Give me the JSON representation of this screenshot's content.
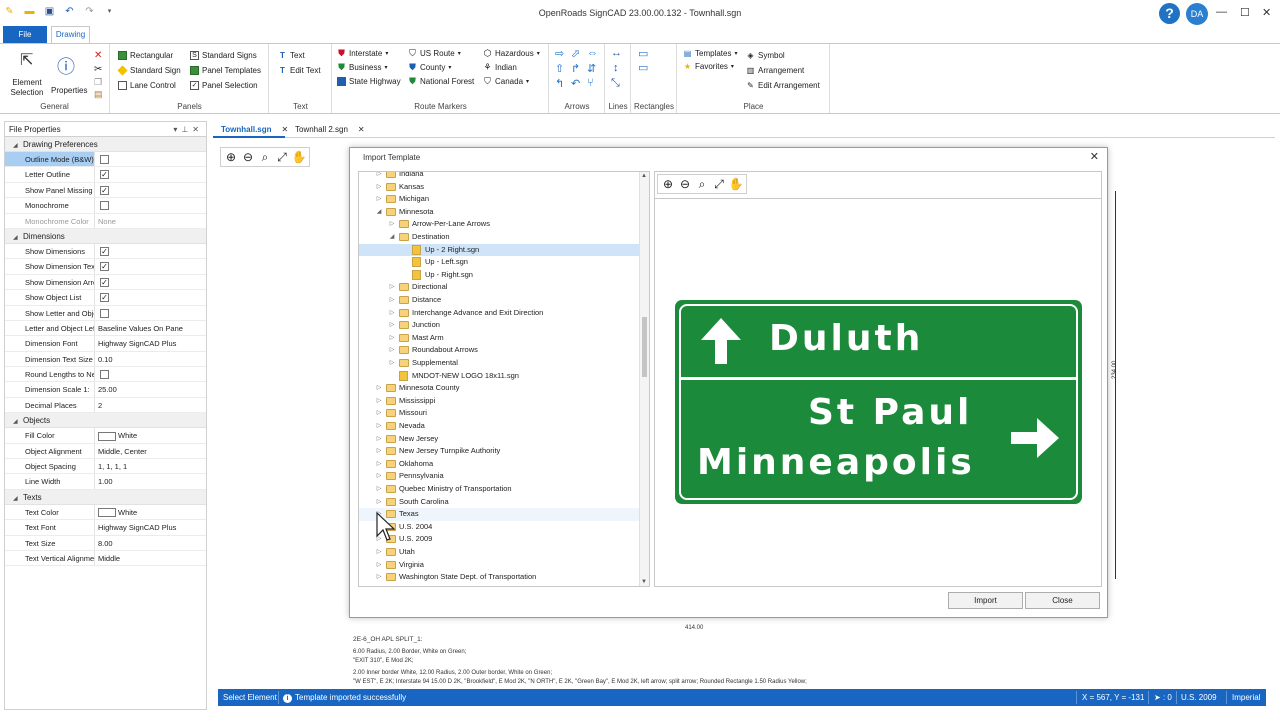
{
  "app": {
    "title": "OpenRoads SignCAD 23.00.00.132 - Townhall.sgn",
    "user_initials": "DA"
  },
  "ribbon": {
    "tabs": [
      "File",
      "Drawing"
    ],
    "general": {
      "label": "General",
      "element_selection": "Element Selection",
      "properties": "Properties"
    },
    "panels": {
      "label": "Panels",
      "rectangular": "Rectangular",
      "standard_sign": "Standard Sign",
      "lane_control": "Lane Control",
      "standard_signs": "Standard Signs",
      "panel_templates": "Panel Templates",
      "panel_selection": "Panel Selection"
    },
    "text": {
      "label": "Text",
      "text": "Text",
      "edit_text": "Edit Text"
    },
    "route_markers": {
      "label": "Route Markers",
      "interstate": "Interstate",
      "business": "Business",
      "state_highway": "State Highway",
      "us_route": "US Route",
      "county": "County",
      "national_forest": "National Forest",
      "hazardous": "Hazardous",
      "indian": "Indian",
      "canada": "Canada"
    },
    "arrows": {
      "label": "Arrows"
    },
    "lines": {
      "label": "Lines"
    },
    "rectangles": {
      "label": "Rectangles"
    },
    "place": {
      "label": "Place",
      "templates": "Templates",
      "favorites": "Favorites",
      "symbol": "Symbol",
      "arrangement": "Arrangement",
      "edit_arrangement": "Edit Arrangement"
    }
  },
  "properties_panel": {
    "title": "File Properties",
    "categories": [
      {
        "name": "Drawing Preferences",
        "rows": [
          {
            "name": "Outline Mode (B&W)",
            "type": "check",
            "checked": false,
            "selected": true
          },
          {
            "name": "Letter Outline",
            "type": "check",
            "checked": true
          },
          {
            "name": "Show Panel Missing Ed...",
            "type": "check",
            "checked": true
          },
          {
            "name": "Monochrome",
            "type": "check",
            "checked": false
          },
          {
            "name": "Monochrome Color",
            "type": "text",
            "value": "None",
            "disabled": true
          }
        ]
      },
      {
        "name": "Dimensions",
        "rows": [
          {
            "name": "Show Dimensions",
            "type": "check",
            "checked": true
          },
          {
            "name": "Show Dimension Texts",
            "type": "check",
            "checked": true
          },
          {
            "name": "Show Dimension Arrows",
            "type": "check",
            "checked": true
          },
          {
            "name": "Show Object List",
            "type": "check",
            "checked": true
          },
          {
            "name": "Show Letter and Object...",
            "type": "check",
            "checked": false
          },
          {
            "name": "Letter and Object Lefts...",
            "type": "text",
            "value": "Baseline Values On Pane"
          },
          {
            "name": "Dimension Font",
            "type": "text",
            "value": "Highway SignCAD Plus"
          },
          {
            "name": "Dimension Text Size",
            "type": "text",
            "value": "0.10"
          },
          {
            "name": "Round Lengths to Neare...",
            "type": "check",
            "checked": false
          },
          {
            "name": "Dimension Scale 1:",
            "type": "text",
            "value": "25.00"
          },
          {
            "name": "Decimal Places",
            "type": "text",
            "value": "2"
          }
        ]
      },
      {
        "name": "Objects",
        "rows": [
          {
            "name": "Fill Color",
            "type": "color",
            "value": "White"
          },
          {
            "name": "Object Alignment",
            "type": "text",
            "value": "Middle, Center"
          },
          {
            "name": "Object Spacing",
            "type": "text",
            "value": "1, 1, 1, 1"
          },
          {
            "name": "Line Width",
            "type": "text",
            "value": "1.00"
          }
        ]
      },
      {
        "name": "Texts",
        "rows": [
          {
            "name": "Text Color",
            "type": "color",
            "value": "White"
          },
          {
            "name": "Text Font",
            "type": "text",
            "value": "Highway SignCAD Plus"
          },
          {
            "name": "Text Size",
            "type": "text",
            "value": "8.00"
          },
          {
            "name": "Text Vertical Alignment",
            "type": "text",
            "value": "Middle"
          }
        ]
      }
    ]
  },
  "doc_tabs": [
    {
      "label": "Townhall.sgn",
      "active": true
    },
    {
      "label": "Townhall 2.sgn",
      "active": false
    }
  ],
  "background_drawing": {
    "title_line": "2E-6_OH APL SPLIT_1:",
    "lines": [
      "6.00 Radius, 2.00 Border, White on Green;",
      "\"EXIT 310\",  E Mod 2K;",
      "2.00 Inner border White, 12.00 Radius, 2.00 Outer border, White on Green;",
      "\"W EST\",  E 2K; Interstate 94 15.00 D 2K, \"Brookfield\",  E Mod 2K, \"N ORTH\",  E 2K, \"Green Bay\",  E Mod 2K, left arrow; split arrow; Rounded Rectangle 1.50 Radius Yellow;"
    ],
    "dimension_width": "414.00",
    "dimension_height": "234.00"
  },
  "dialog": {
    "title": "Import Template",
    "tree": [
      {
        "label": "Indiana",
        "level": 0,
        "expander": "collapsed",
        "kind": "folder"
      },
      {
        "label": "Kansas",
        "level": 0,
        "expander": "collapsed",
        "kind": "folder"
      },
      {
        "label": "Michigan",
        "level": 0,
        "expander": "collapsed",
        "kind": "folder"
      },
      {
        "label": "Minnesota",
        "level": 0,
        "expander": "expanded",
        "kind": "folder"
      },
      {
        "label": "Arrow-Per-Lane Arrows",
        "level": 1,
        "expander": "collapsed",
        "kind": "folder"
      },
      {
        "label": "Destination",
        "level": 1,
        "expander": "expanded",
        "kind": "folder"
      },
      {
        "label": "Up - 2 Right.sgn",
        "level": 2,
        "expander": "none",
        "kind": "file",
        "selected": true
      },
      {
        "label": "Up - Left.sgn",
        "level": 2,
        "expander": "none",
        "kind": "file"
      },
      {
        "label": "Up - Right.sgn",
        "level": 2,
        "expander": "none",
        "kind": "file"
      },
      {
        "label": "Directional",
        "level": 1,
        "expander": "collapsed",
        "kind": "folder"
      },
      {
        "label": "Distance",
        "level": 1,
        "expander": "collapsed",
        "kind": "folder"
      },
      {
        "label": "Interchange Advance and Exit Direction",
        "level": 1,
        "expander": "collapsed",
        "kind": "folder"
      },
      {
        "label": "Junction",
        "level": 1,
        "expander": "collapsed",
        "kind": "folder"
      },
      {
        "label": "Mast Arm",
        "level": 1,
        "expander": "collapsed",
        "kind": "folder"
      },
      {
        "label": "Roundabout Arrows",
        "level": 1,
        "expander": "collapsed",
        "kind": "folder"
      },
      {
        "label": "Supplemental",
        "level": 1,
        "expander": "collapsed",
        "kind": "folder"
      },
      {
        "label": "MNDOT-NEW LOGO 18x11.sgn",
        "level": 1,
        "expander": "none",
        "kind": "file"
      },
      {
        "label": "Minnesota County",
        "level": 0,
        "expander": "collapsed",
        "kind": "folder"
      },
      {
        "label": "Mississippi",
        "level": 0,
        "expander": "collapsed",
        "kind": "folder"
      },
      {
        "label": "Missouri",
        "level": 0,
        "expander": "collapsed",
        "kind": "folder"
      },
      {
        "label": "Nevada",
        "level": 0,
        "expander": "collapsed",
        "kind": "folder"
      },
      {
        "label": "New Jersey",
        "level": 0,
        "expander": "collapsed",
        "kind": "folder"
      },
      {
        "label": "New Jersey Turnpike Authority",
        "level": 0,
        "expander": "collapsed",
        "kind": "folder"
      },
      {
        "label": "Oklahoma",
        "level": 0,
        "expander": "collapsed",
        "kind": "folder"
      },
      {
        "label": "Pennsylvania",
        "level": 0,
        "expander": "collapsed",
        "kind": "folder"
      },
      {
        "label": "Quebec Ministry of Transportation",
        "level": 0,
        "expander": "collapsed",
        "kind": "folder"
      },
      {
        "label": "South Carolina",
        "level": 0,
        "expander": "collapsed",
        "kind": "folder"
      },
      {
        "label": "Texas",
        "level": 0,
        "expander": "collapsed",
        "kind": "folder",
        "hover": true
      },
      {
        "label": "U.S. 2004",
        "level": 0,
        "expander": "collapsed",
        "kind": "folder"
      },
      {
        "label": "U.S. 2009",
        "level": 0,
        "expander": "collapsed",
        "kind": "folder"
      },
      {
        "label": "Utah",
        "level": 0,
        "expander": "collapsed",
        "kind": "folder"
      },
      {
        "label": "Virginia",
        "level": 0,
        "expander": "collapsed",
        "kind": "folder"
      },
      {
        "label": "Washington State Dept. of Transportation",
        "level": 0,
        "expander": "collapsed",
        "kind": "folder"
      }
    ],
    "preview_sign": {
      "background": "#1b8a3a",
      "line1": "Duluth",
      "line2": "St Paul",
      "line3": "Minneapolis",
      "arrow1": "up-arrow-icon",
      "arrow2": "right-arrow-icon"
    },
    "import_label": "Import",
    "close_label": "Close"
  },
  "status_bar": {
    "left": "Select Element",
    "message": "Template imported successfully",
    "coords": "X = 567, Y = -131",
    "selection": ": 0",
    "standard": "U.S. 2009",
    "units": "Imperial"
  },
  "colors": {
    "accent": "#1866c1",
    "sign_green": "#1b8a3a",
    "selection": "#a8cff3"
  }
}
